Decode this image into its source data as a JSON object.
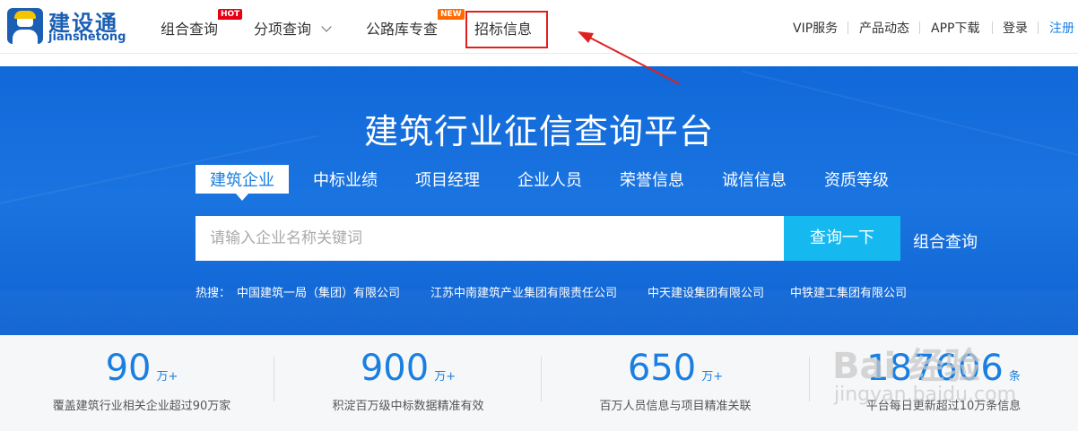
{
  "logo": {
    "title": "建设通",
    "subtitle": "jianshetong"
  },
  "nav": {
    "items": [
      {
        "label": "组合查询",
        "badge": "HOT"
      },
      {
        "label": "分项查询"
      },
      {
        "label": "公路库专查",
        "badge": "NEW"
      },
      {
        "label": "招标信息"
      }
    ],
    "right": [
      "VIP服务",
      "产品动态",
      "APP下载",
      "登录",
      "注册"
    ]
  },
  "banner": {
    "title": "建筑行业征信查询平台",
    "tabs": [
      "建筑企业",
      "中标业绩",
      "项目经理",
      "企业人员",
      "荣誉信息",
      "诚信信息",
      "资质等级"
    ],
    "search_placeholder": "请输入企业名称关键词",
    "search_button": "查询一下",
    "combo_link": "组合查询",
    "hot_label": "热搜：",
    "hot_links": [
      "中国建筑一局（集团）有限公司",
      "江苏中南建筑产业集团有限责任公司",
      "中天建设集团有限公司",
      "中铁建工集团有限公司"
    ]
  },
  "stats": [
    {
      "number": "90",
      "unit": "万+",
      "desc": "覆盖建筑行业相关企业超过90万家"
    },
    {
      "number": "900",
      "unit": "万+",
      "desc": "积淀百万级中标数据精准有效"
    },
    {
      "number": "650",
      "unit": "万+",
      "desc": "百万人员信息与项目精准关联"
    },
    {
      "number": "187606",
      "unit": "条",
      "desc": "平台每日更新超过10万条信息"
    }
  ],
  "watermark": {
    "big": "Bai 经验",
    "small": "jingyan.baidu.com"
  },
  "colors": {
    "brand": "#1a5fb4",
    "banner": "#1a74e0",
    "button": "#15b9f0",
    "stat": "#1a7fe0",
    "highlight": "#e02020"
  }
}
